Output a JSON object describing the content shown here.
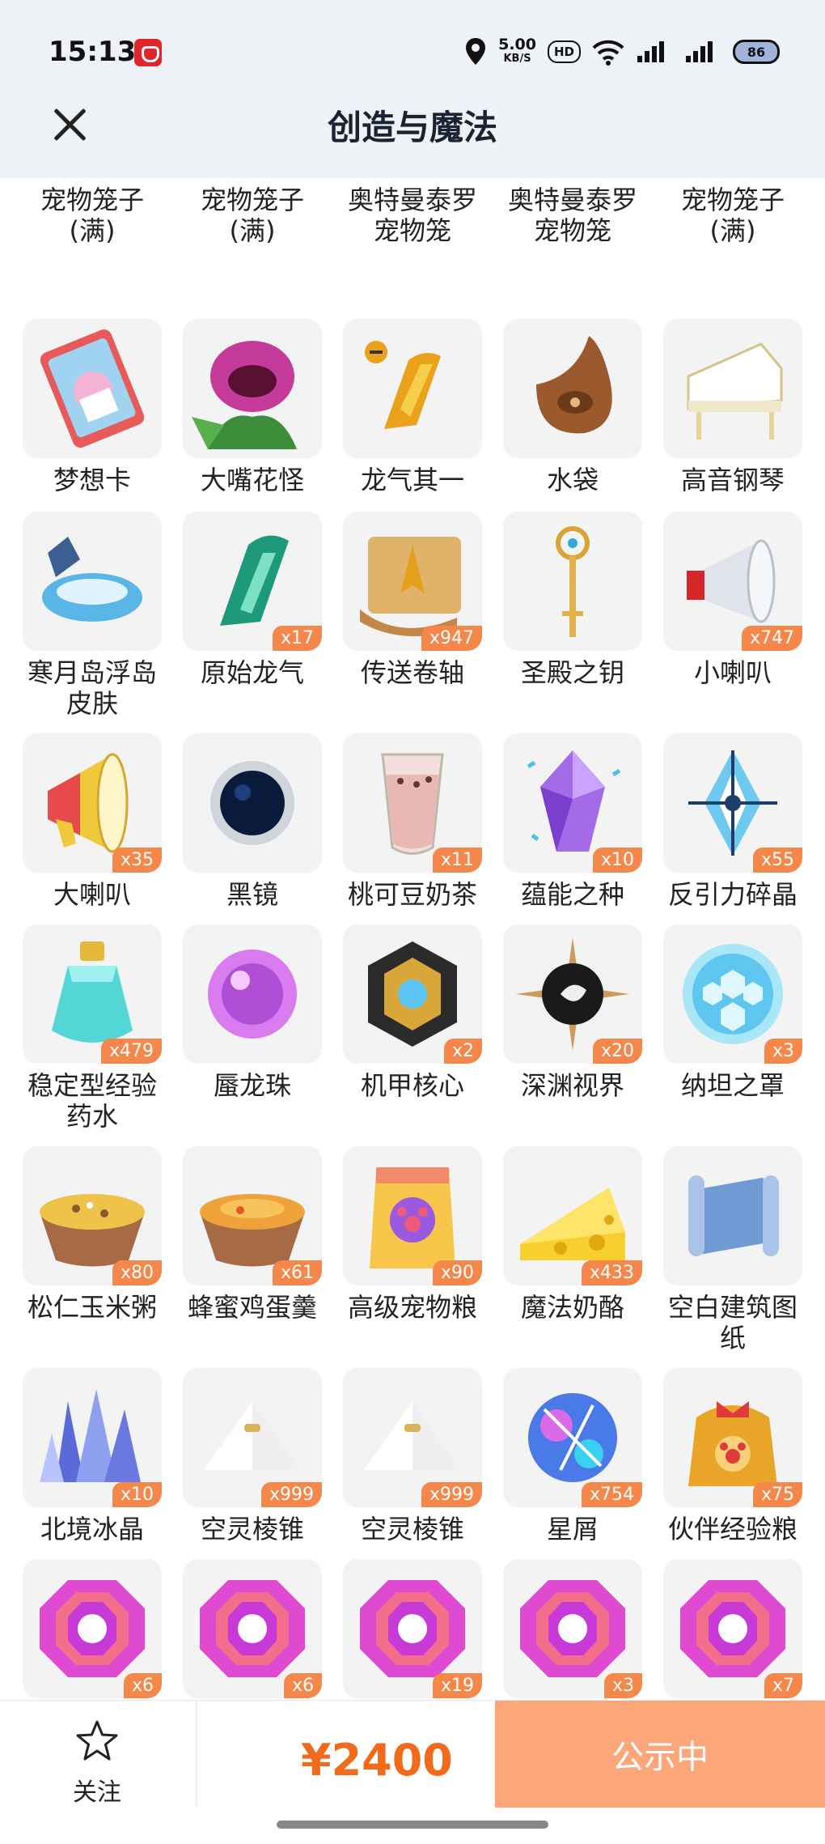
{
  "status": {
    "time": "15:13",
    "speed": "5.00",
    "speed_unit": "KB/S",
    "hd": "HD",
    "battery": "86"
  },
  "header": {
    "title": "创造与魔法"
  },
  "items": [
    {
      "name": "宠物笼子(满)",
      "lines": [
        "宠物笼子",
        "(满)"
      ],
      "count": "",
      "icon": "cage-gray-icon"
    },
    {
      "name": "宠物笼子(满)",
      "lines": [
        "宠物笼子",
        "(满)"
      ],
      "count": "",
      "icon": "cage-gray-icon"
    },
    {
      "name": "奥特曼泰罗宠物笼",
      "lines": [
        "奥特曼泰罗",
        "宠物笼"
      ],
      "count": "",
      "icon": "cage-blue-icon"
    },
    {
      "name": "奥特曼泰罗宠物笼",
      "lines": [
        "奥特曼泰罗",
        "宠物笼"
      ],
      "count": "",
      "icon": "cage-blue-icon"
    },
    {
      "name": "宠物笼子(满)",
      "lines": [
        "宠物笼子",
        "(满)"
      ],
      "count": "",
      "icon": "cage-gray-icon"
    },
    {
      "name": "梦想卡",
      "lines": [
        "梦想卡"
      ],
      "count": "",
      "icon": "dream-card-icon"
    },
    {
      "name": "大嘴花怪",
      "lines": [
        "大嘴花怪"
      ],
      "count": "",
      "icon": "piranha-plant-icon"
    },
    {
      "name": "龙气其一",
      "lines": [
        "龙气其一"
      ],
      "count": "",
      "icon": "dragon-qi-gold-icon"
    },
    {
      "name": "水袋",
      "lines": [
        "水袋"
      ],
      "count": "",
      "icon": "water-bag-icon"
    },
    {
      "name": "高音钢琴",
      "lines": [
        "高音钢琴"
      ],
      "count": "",
      "icon": "piano-icon"
    },
    {
      "name": "寒月岛浮岛皮肤",
      "lines": [
        "寒月岛浮岛",
        "皮肤"
      ],
      "count": "",
      "icon": "floating-island-icon"
    },
    {
      "name": "原始龙气",
      "lines": [
        "原始龙气"
      ],
      "count": "x17",
      "icon": "dragon-qi-green-icon"
    },
    {
      "name": "传送卷轴",
      "lines": [
        "传送卷轴"
      ],
      "count": "x947",
      "icon": "scroll-icon"
    },
    {
      "name": "圣殿之钥",
      "lines": [
        "圣殿之钥"
      ],
      "count": "",
      "icon": "key-icon"
    },
    {
      "name": "小喇叭",
      "lines": [
        "小喇叭"
      ],
      "count": "x747",
      "icon": "small-megaphone-icon"
    },
    {
      "name": "大喇叭",
      "lines": [
        "大喇叭"
      ],
      "count": "x35",
      "icon": "big-megaphone-icon"
    },
    {
      "name": "黑镜",
      "lines": [
        "黑镜"
      ],
      "count": "",
      "icon": "black-mirror-icon"
    },
    {
      "name": "桃可豆奶茶",
      "lines": [
        "桃可豆奶茶"
      ],
      "count": "x11",
      "icon": "milk-tea-icon"
    },
    {
      "name": "蕴能之种",
      "lines": [
        "蕴能之种"
      ],
      "count": "x10",
      "icon": "purple-crystal-icon"
    },
    {
      "name": "反引力碎晶",
      "lines": [
        "反引力碎晶"
      ],
      "count": "x55",
      "icon": "anti-gravity-crystal-icon"
    },
    {
      "name": "稳定型经验药水",
      "lines": [
        "稳定型经验",
        "药水"
      ],
      "count": "x479",
      "icon": "potion-icon"
    },
    {
      "name": "蜃龙珠",
      "lines": [
        "蜃龙珠"
      ],
      "count": "",
      "icon": "purple-orb-icon"
    },
    {
      "name": "机甲核心",
      "lines": [
        "机甲核心"
      ],
      "count": "x2",
      "icon": "mech-core-icon"
    },
    {
      "name": "深渊视界",
      "lines": [
        "深渊视界"
      ],
      "count": "x20",
      "icon": "abyss-eye-icon"
    },
    {
      "name": "纳坦之罩",
      "lines": [
        "纳坦之罩"
      ],
      "count": "x3",
      "icon": "hex-shield-icon"
    },
    {
      "name": "松仁玉米粥",
      "lines": [
        "松仁玉米粥"
      ],
      "count": "x80",
      "icon": "corn-porridge-icon"
    },
    {
      "name": "蜂蜜鸡蛋羹",
      "lines": [
        "蜂蜜鸡蛋羹"
      ],
      "count": "x61",
      "icon": "egg-custard-icon"
    },
    {
      "name": "高级宠物粮",
      "lines": [
        "高级宠物粮"
      ],
      "count": "x90",
      "icon": "pet-food-bag-icon"
    },
    {
      "name": "魔法奶酪",
      "lines": [
        "魔法奶酪"
      ],
      "count": "x433",
      "icon": "cheese-icon"
    },
    {
      "name": "空白建筑图纸",
      "lines": [
        "空白建筑图",
        "纸"
      ],
      "count": "",
      "icon": "blueprint-icon"
    },
    {
      "name": "北境冰晶",
      "lines": [
        "北境冰晶"
      ],
      "count": "x10",
      "icon": "ice-crystal-icon"
    },
    {
      "name": "空灵棱锥",
      "lines": [
        "空灵棱锥"
      ],
      "count": "x999",
      "icon": "white-pyramid-icon"
    },
    {
      "name": "空灵棱锥",
      "lines": [
        "空灵棱锥"
      ],
      "count": "x999",
      "icon": "white-pyramid-icon"
    },
    {
      "name": "星屑",
      "lines": [
        "星屑"
      ],
      "count": "x754",
      "icon": "stardust-icon"
    },
    {
      "name": "伙伴经验粮",
      "lines": [
        "伙伴经验粮"
      ],
      "count": "x75",
      "icon": "exp-food-bag-icon"
    },
    {
      "name": "",
      "lines": [
        ""
      ],
      "count": "x6",
      "icon": "gem-bow-icon"
    },
    {
      "name": "",
      "lines": [
        ""
      ],
      "count": "x6",
      "icon": "gem-mask-icon"
    },
    {
      "name": "",
      "lines": [
        ""
      ],
      "count": "x19",
      "icon": "gem-flame-icon"
    },
    {
      "name": "",
      "lines": [
        ""
      ],
      "count": "x3",
      "icon": "gem-serpent-icon"
    },
    {
      "name": "",
      "lines": [
        ""
      ],
      "count": "x7",
      "icon": "gem-egg-icon"
    }
  ],
  "footer": {
    "follow_label": "关注",
    "price": "¥2400",
    "cta_label": "公示中"
  },
  "colors": {
    "accent": "#f26a1b",
    "count_badge": "#f5874a",
    "cta_bg": "#fca67a",
    "header_bg": "#eef1f5"
  }
}
